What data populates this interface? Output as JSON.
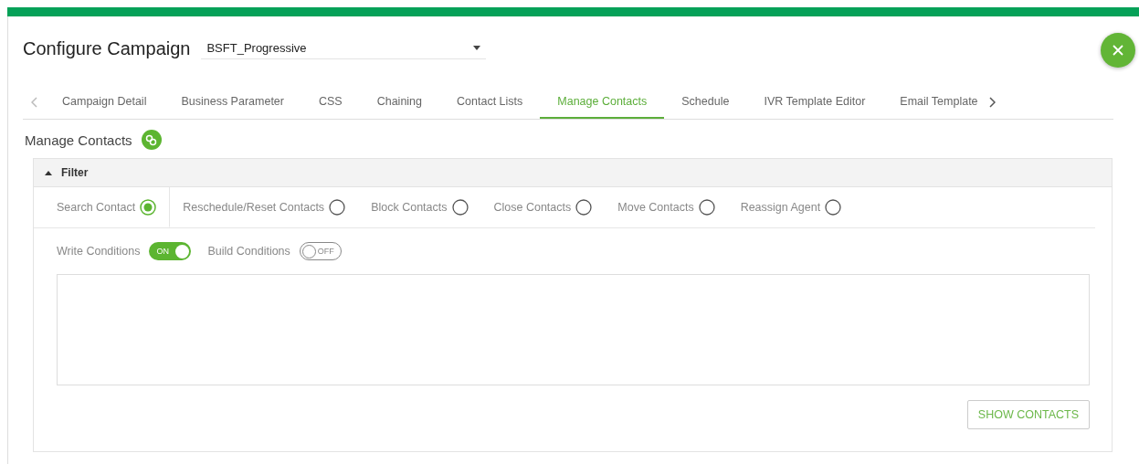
{
  "title": "Configure Campaign",
  "campaign_select": {
    "value": "BSFT_Progressive"
  },
  "tabs": [
    {
      "label": "Campaign Detail",
      "selected": false
    },
    {
      "label": "Business Parameter",
      "selected": false
    },
    {
      "label": "CSS",
      "selected": false
    },
    {
      "label": "Chaining",
      "selected": false
    },
    {
      "label": "Contact Lists",
      "selected": false
    },
    {
      "label": "Manage Contacts",
      "selected": true
    },
    {
      "label": "Schedule",
      "selected": false
    },
    {
      "label": "IVR Template Editor",
      "selected": false
    },
    {
      "label": "Email Template",
      "selected": false
    }
  ],
  "section_title": "Manage Contacts",
  "filter": {
    "title": "Filter",
    "expanded": true,
    "actions": [
      {
        "label": "Search Contact",
        "selected": true
      },
      {
        "label": "Reschedule/Reset Contacts",
        "selected": false
      },
      {
        "label": "Block Contacts",
        "selected": false
      },
      {
        "label": "Close Contacts",
        "selected": false
      },
      {
        "label": "Move Contacts",
        "selected": false
      },
      {
        "label": "Reassign Agent",
        "selected": false
      }
    ],
    "toggles": [
      {
        "label": "Write Conditions",
        "on": true,
        "state_text": "ON"
      },
      {
        "label": "Build Conditions",
        "on": false,
        "state_text": "OFF"
      }
    ],
    "button": "SHOW CONTACTS"
  }
}
